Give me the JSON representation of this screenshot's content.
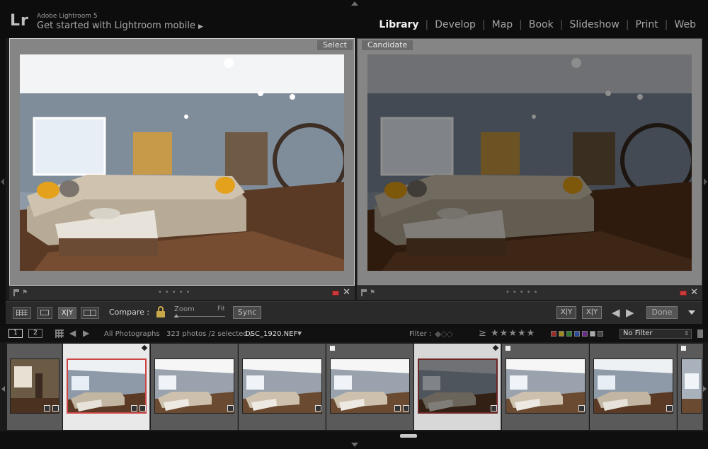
{
  "app": {
    "logo": "Lr",
    "name": "Adobe Lightroom 5",
    "mobile_link": "Get started with Lightroom mobile"
  },
  "modules": [
    "Library",
    "Develop",
    "Map",
    "Book",
    "Slideshow",
    "Print",
    "Web"
  ],
  "active_module": "Library",
  "compare": {
    "select_label": "Select",
    "candidate_label": "Candidate"
  },
  "toolbar": {
    "compare_label": "Compare :",
    "zoom_label": "Zoom",
    "fit_label": "Fit",
    "sync_label": "Sync",
    "xy_label": "X|Y",
    "swap_label": "X|Y",
    "done_label": "Done",
    "zoom_level": 0
  },
  "filmstrip_header": {
    "page1": "1",
    "page2": "2",
    "source": "All Photographs",
    "count": "323 photos /2 selected /",
    "filename": "DSC_1920.NEF",
    "filter_label": "Filter :",
    "stars": "≥ ★★★★★",
    "filter_value": "No Filter"
  },
  "colors": {
    "accent_red": "#cc3b3b",
    "lock_gold": "#c9a84a"
  },
  "filmstrip": {
    "thumbnail_count": 8,
    "selected_indices": [
      1,
      5
    ]
  }
}
